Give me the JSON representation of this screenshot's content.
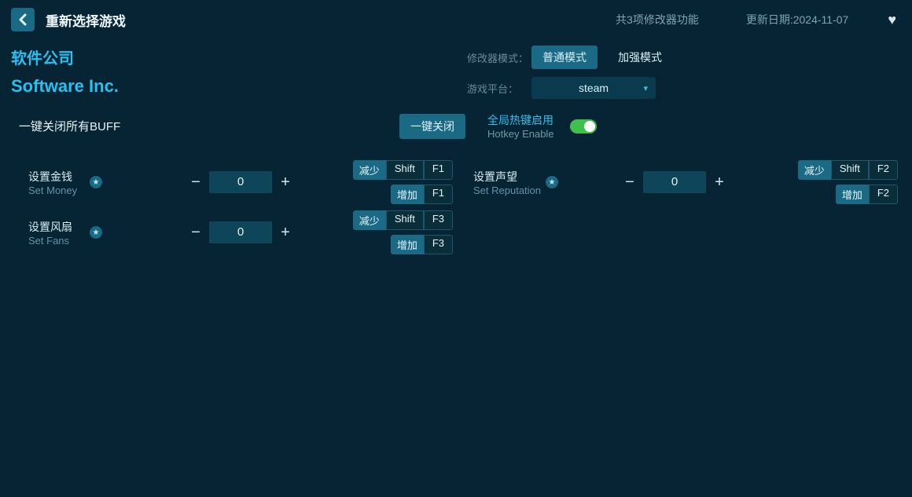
{
  "header": {
    "title": "重新选择游戏",
    "features_count": "共3项修改器功能",
    "update_date": "更新日期:2024-11-07"
  },
  "game": {
    "name_cn": "软件公司",
    "name_en": "Software Inc."
  },
  "config": {
    "mode_label": "修改器模式：",
    "mode_normal": "普通模式",
    "mode_enhanced": "加强模式",
    "platform_label": "游戏平台：",
    "platform_value": "steam"
  },
  "buff": {
    "label": "一键关闭所有BUFF",
    "button": "一键关闭"
  },
  "hotkey_enable": {
    "cn": "全局热键启用",
    "en": "Hotkey Enable"
  },
  "hk": {
    "decrease": "减少",
    "increase": "增加",
    "shift": "Shift",
    "f1": "F1",
    "f2": "F2",
    "f3": "F3"
  },
  "cheats": [
    {
      "cn": "设置金钱",
      "en": "Set Money",
      "value": "0",
      "fkey": "F1"
    },
    {
      "cn": "设置声望",
      "en": "Set Reputation",
      "value": "0",
      "fkey": "F2"
    },
    {
      "cn": "设置风扇",
      "en": "Set Fans",
      "value": "0",
      "fkey": "F3"
    }
  ]
}
